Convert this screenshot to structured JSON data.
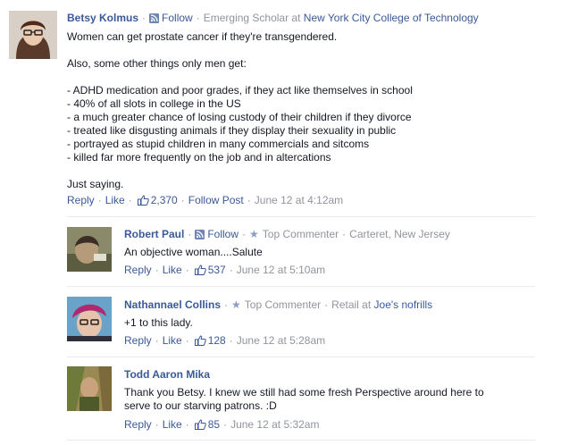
{
  "comments": [
    {
      "author": "Betsy Kolmus",
      "follow": "Follow",
      "meta_text": "Emerging Scholar at ",
      "meta_link": "New York City College of Technology",
      "lines": [
        "Women can get prostate cancer if they're transgendered.",
        "Also, some other things only men get:",
        "- ADHD medication and poor grades, if they act like themselves in school",
        "- 40% of all slots in college in the US",
        "- a much greater chance of losing custody of their children if they divorce",
        "- treated like disgusting animals if they display their sexuality in public",
        "- portrayed as stupid children in many commercials and sitcoms",
        "- killed far more frequently on the job and in altercations",
        "Just saying."
      ],
      "reply": "Reply",
      "like": "Like",
      "likes": "2,370",
      "follow_post": "Follow Post",
      "time": "June 12 at 4:12am"
    }
  ],
  "replies": [
    {
      "author": "Robert Paul",
      "follow": "Follow",
      "badge": "Top Commenter",
      "location": "Carteret, New Jersey",
      "text": "An objective woman....Salute",
      "reply": "Reply",
      "like": "Like",
      "likes": "537",
      "time": "June 12 at 5:10am"
    },
    {
      "author": "Nathannael Collins",
      "badge": "Top Commenter",
      "meta_text": "Retail at ",
      "meta_link": "Joe's nofrills",
      "text": "+1 to this lady.",
      "reply": "Reply",
      "like": "Like",
      "likes": "128",
      "time": "June 12 at 5:28am"
    },
    {
      "author": "Todd Aaron Mika",
      "text_lines": [
        "Thank you Betsy. I knew we still had some fresh Perspective around here to",
        "serve to our starving patrons. :D"
      ],
      "reply": "Reply",
      "like": "Like",
      "likes": "85",
      "time": "June 12 at 5:32am"
    }
  ],
  "separator": "·",
  "icons": [
    "rss-follow-icon",
    "star-icon",
    "thumbs-up-icon"
  ],
  "colors": {
    "link": "#3b5998",
    "meta": "#90949c",
    "text": "#141823",
    "divider": "#e9ebee"
  }
}
